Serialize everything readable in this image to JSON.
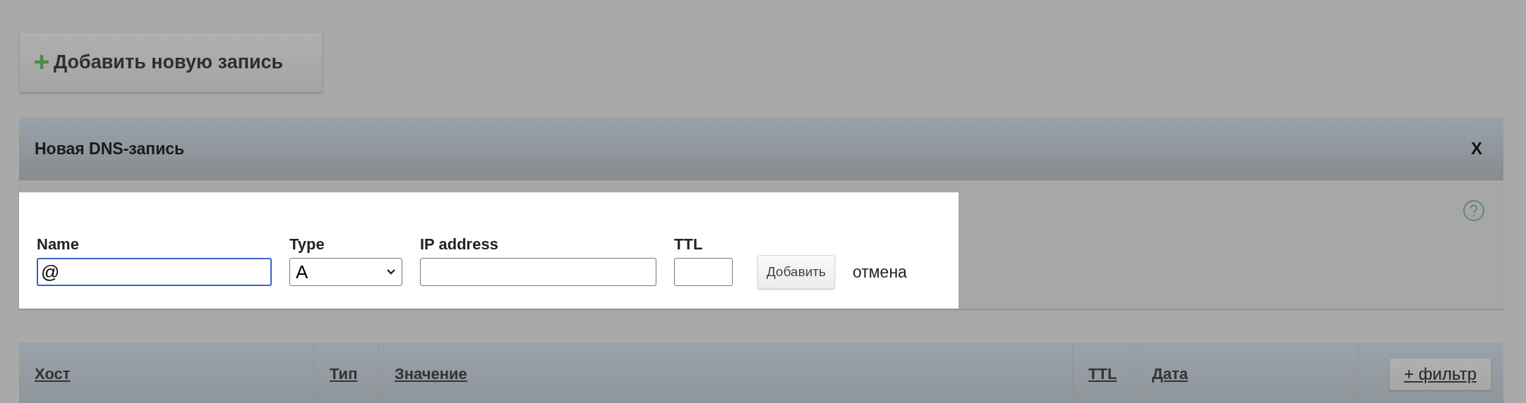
{
  "add_button": {
    "label": "Добавить новую запись"
  },
  "panel": {
    "title": "Новая DNS-запись",
    "close": "X",
    "fields": [
      {
        "kind": "text",
        "label": "Name",
        "value": "@",
        "focused": true
      },
      {
        "kind": "select",
        "label": "Type",
        "value": "A",
        "focused": false
      },
      {
        "kind": "text",
        "label": "IP address",
        "focused": false
      },
      {
        "kind": "text",
        "label": "TTL",
        "focused": false
      }
    ],
    "submit": "Добавить",
    "cancel": "отмена"
  },
  "table": {
    "columns": [
      "Хост",
      "Тип",
      "Значение",
      "TTL",
      "Дата"
    ],
    "filter_button": "+ фильтр"
  }
}
